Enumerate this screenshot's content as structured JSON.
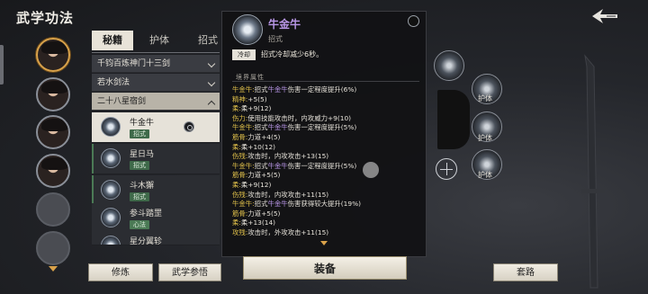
{
  "header": {
    "title": "武学功法"
  },
  "tabs": [
    {
      "label": "秘籍"
    },
    {
      "label": "护体"
    },
    {
      "label": "招式"
    }
  ],
  "groups": [
    {
      "label": "千钧百炼神门十三剑"
    },
    {
      "label": "若水剑法"
    },
    {
      "label": "二十八星宿剑"
    }
  ],
  "skills": [
    {
      "name": "牛金牛",
      "tag": "招式"
    },
    {
      "name": "星日马",
      "tag": "招式"
    },
    {
      "name": "斗木獬",
      "tag": "招式"
    },
    {
      "name": "参斗踏罡",
      "tag": "心法"
    },
    {
      "name": "星分翼轸",
      "tag": ""
    }
  ],
  "detail": {
    "title": "牛金牛",
    "type": "招式",
    "cd_badge": "冷却",
    "cd_text": "招式冷却减少6秒。",
    "section_header": "境界属性",
    "lines": [
      {
        "k": "牛金牛:",
        "v": "招式",
        "p": "牛金牛",
        "rest": "伤害一定程度提升(6%)"
      },
      {
        "k": "精神:",
        "v": "+5(5)"
      },
      {
        "k": "柔:",
        "v": "柔+9(12)"
      },
      {
        "k": "伤力:",
        "v": "使用技能攻击时，内攻威力+9(10)"
      },
      {
        "k": "牛金牛:",
        "v": "招式",
        "p": "牛金牛",
        "rest": "伤害一定程度提升(5%)"
      },
      {
        "k": "筋骨:",
        "v": "力道+4(5)"
      },
      {
        "k": "柔:",
        "v": "柔+10(12)"
      },
      {
        "k": "伤残:",
        "v": "攻击时，内攻攻击+13(15)"
      },
      {
        "k": "牛金牛:",
        "v": "招式",
        "p": "牛金牛",
        "rest": "伤害一定程度提升(5%)"
      },
      {
        "k": "筋骨:",
        "v": "力道+5(5)"
      },
      {
        "k": "柔:",
        "v": "柔+9(12)"
      },
      {
        "k": "伤残:",
        "v": "攻击时，内攻攻击+11(15)"
      },
      {
        "k": "牛金牛:",
        "v": "招式",
        "p": "牛金牛",
        "rest": "伤害获得较大提升(19%)"
      },
      {
        "k": "筋骨:",
        "v": "力道+5(5)"
      },
      {
        "k": "柔:",
        "v": "柔+13(14)"
      },
      {
        "k": "攻残:",
        "v": "攻击时，外攻攻击+11(15)"
      }
    ]
  },
  "slots": [
    {
      "label": "护体"
    },
    {
      "label": "护体"
    },
    {
      "label": "护体"
    }
  ],
  "buttons": {
    "xiulian": "修炼",
    "canwu": "武学参悟",
    "zhuangbei": "装备",
    "taolu": "套路"
  }
}
